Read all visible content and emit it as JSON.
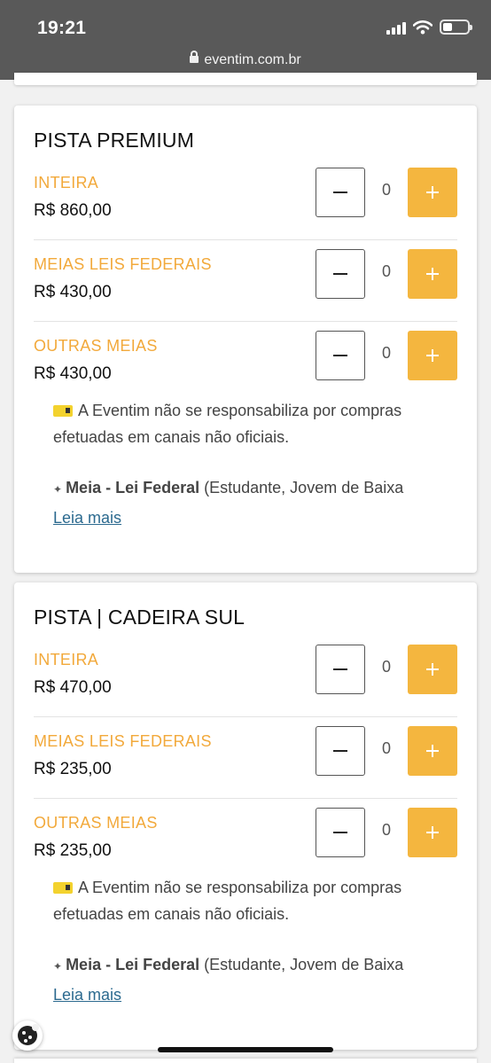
{
  "status_bar": {
    "time": "19:21"
  },
  "browser": {
    "url": "eventim.com.br"
  },
  "sections": [
    {
      "title": "PISTA PREMIUM",
      "tickets": [
        {
          "label": "INTEIRA",
          "price": "R$ 860,00",
          "quantity": "0"
        },
        {
          "label": "MEIAS LEIS FEDERAIS",
          "price": "R$ 430,00",
          "quantity": "0"
        },
        {
          "label": "OUTRAS MEIAS",
          "price": "R$ 430,00",
          "quantity": "0"
        }
      ],
      "notice": "A Eventim não se responsabiliza por compras efetuadas em canais não oficiais.",
      "info_bold": "Meia - Lei Federal",
      "info_text": " (Estudante, Jovem de Baixa",
      "read_more": "Leia mais"
    },
    {
      "title": "PISTA | CADEIRA SUL",
      "tickets": [
        {
          "label": "INTEIRA",
          "price": "R$ 470,00",
          "quantity": "0"
        },
        {
          "label": "MEIAS LEIS FEDERAIS",
          "price": "R$ 235,00",
          "quantity": "0"
        },
        {
          "label": "OUTRAS MEIAS",
          "price": "R$ 235,00",
          "quantity": "0"
        }
      ],
      "notice": "A Eventim não se responsabiliza por compras efetuadas em canais não oficiais.",
      "info_bold": "Meia - Lei Federal",
      "info_text": " (Estudante, Jovem de Baixa",
      "read_more": "Leia mais"
    }
  ],
  "icons": {
    "minus": "minus-icon",
    "plus": "plus-icon",
    "ticket": "ticket-icon",
    "sparkle": "sparkle-icon",
    "cookie": "cookie-icon"
  },
  "colors": {
    "label": "#f2a93b",
    "plus_button": "#f4b63f",
    "link": "#2c6a8f",
    "top_bar": "#595959"
  }
}
